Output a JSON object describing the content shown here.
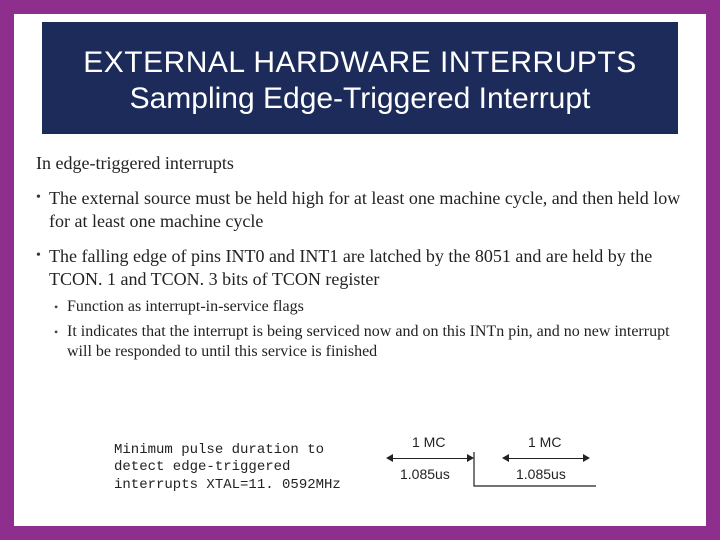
{
  "title": {
    "line1": "EXTERNAL HARDWARE INTERRUPTS",
    "line2": "Sampling Edge-Triggered Interrupt"
  },
  "intro": "In edge-triggered interrupts",
  "bullets": [
    {
      "text": "The external source must be held high for  at least one machine cycle, and then held  low for at least one machine cycle"
    },
    {
      "text": "The falling edge of pins INT0 and INT1  are latched by the 8051 and are held by  the TCON. 1 and TCON. 3 bits of TCON  register"
    }
  ],
  "subbullets": [
    {
      "text": "Function as interrupt-in-service flags"
    },
    {
      "text": "It indicates that the interrupt is being serviced  now and on this INTn pin, and no new interrupt  will be responded to until this service is finished"
    }
  ],
  "diagram": {
    "caption_l1": "Minimum pulse duration to",
    "caption_l2": "detect edge-triggered",
    "caption_l3": "interrupts XTAL=11. 0592MHz",
    "mc_label": "1 MC",
    "us_label": "1.085us"
  }
}
